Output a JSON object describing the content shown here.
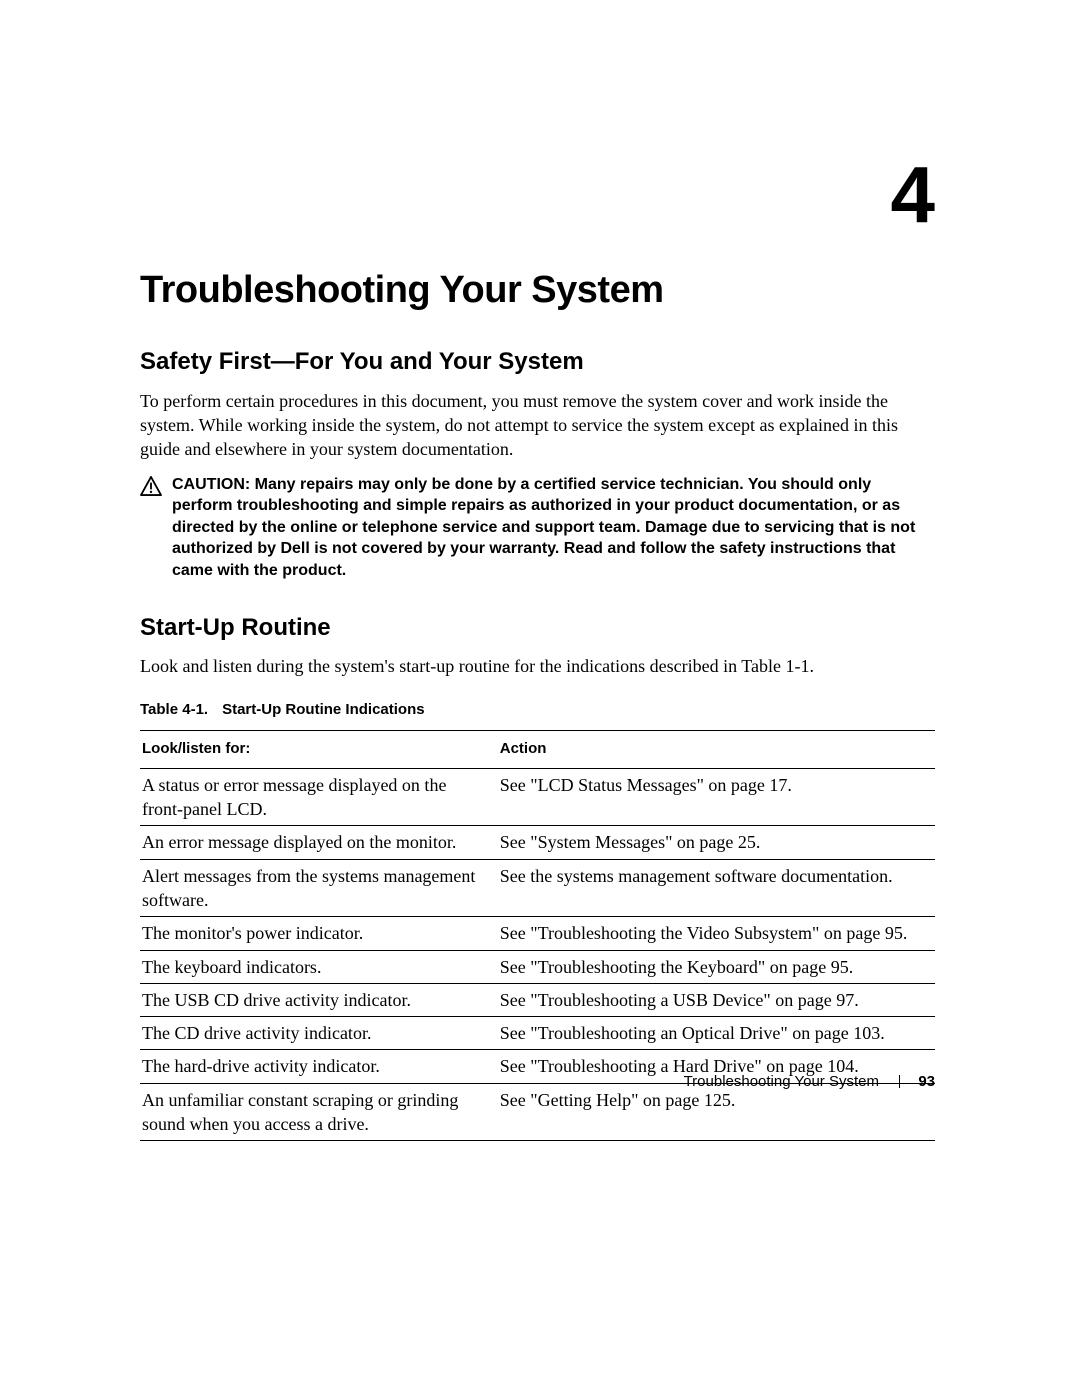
{
  "chapter": {
    "number": "4",
    "title": "Troubleshooting Your System"
  },
  "sections": {
    "safety": {
      "title": "Safety First—For You and Your System",
      "body": "To perform certain procedures in this document, you must remove the system cover and work inside the system. While working inside the system, do not attempt to service the system except as explained in this guide and elsewhere in your system documentation.",
      "caution_label": "CAUTION:",
      "caution_body": "Many repairs may only be done by a certified service technician. You should only perform troubleshooting and simple repairs as authorized in your product documentation, or as directed by the online or telephone service and support team. Damage due to servicing that is not authorized by Dell is not covered by your warranty. Read and follow the safety instructions that came with the product."
    },
    "startup": {
      "title": "Start-Up Routine",
      "body": "Look and listen during the system's start-up routine for the indications described in Table 1-1."
    }
  },
  "table": {
    "caption_prefix": "Table 4-1.",
    "caption_title": "Start-Up Routine Indications",
    "headers": {
      "look": "Look/listen for:",
      "action": "Action"
    },
    "rows": [
      {
        "look": "A status or error message displayed on the front-panel LCD.",
        "action": "See \"LCD Status Messages\" on page 17."
      },
      {
        "look": "An error message displayed on the monitor.",
        "action": "See \"System Messages\" on page 25."
      },
      {
        "look": "Alert messages from the systems management software.",
        "action": "See the systems management software documentation."
      },
      {
        "look": "The monitor's power indicator.",
        "action": "See \"Troubleshooting the Video Subsystem\" on page 95."
      },
      {
        "look": "The keyboard indicators.",
        "action": "See \"Troubleshooting the Keyboard\" on page 95."
      },
      {
        "look": "The USB CD drive activity indicator.",
        "action": "See \"Troubleshooting a USB Device\" on page 97."
      },
      {
        "look": "The CD drive activity indicator.",
        "action": "See \"Troubleshooting an Optical Drive\" on page 103."
      },
      {
        "look": "The hard-drive activity indicator.",
        "action": "See \"Troubleshooting a Hard Drive\" on page 104."
      },
      {
        "look": "An unfamiliar constant scraping or grinding sound when you access a drive.",
        "action": "See \"Getting Help\" on page 125."
      }
    ]
  },
  "footer": {
    "section": "Troubleshooting Your System",
    "page": "93"
  }
}
